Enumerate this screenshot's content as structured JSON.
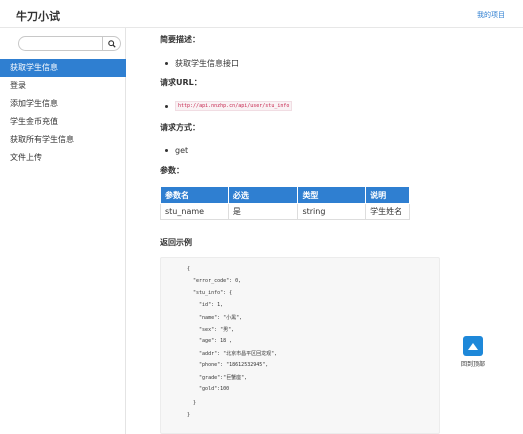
{
  "header": {
    "brand": "牛刀小试",
    "my_projects": "我的项目"
  },
  "search": {
    "value": "",
    "placeholder": ""
  },
  "sidebar": {
    "items": [
      {
        "label": "获取学生信息",
        "active": true
      },
      {
        "label": "登录"
      },
      {
        "label": "添加学生信息"
      },
      {
        "label": "学生金币充值"
      },
      {
        "label": "获取所有学生信息"
      },
      {
        "label": "文件上传"
      }
    ]
  },
  "doc": {
    "summary_heading": "简要描述：",
    "summary_text": "获取学生信息接口",
    "url_heading": "请求URL：",
    "url": "http://api.nnzhp.cn/api/user/stu_info",
    "method_heading": "请求方式：",
    "method": "get",
    "params_heading": "参数：",
    "params_table": {
      "headers": [
        "参数名",
        "必选",
        "类型",
        "说明"
      ],
      "rows": [
        [
          "stu_name",
          "是",
          "string",
          "学生姓名"
        ]
      ]
    },
    "return_heading": "返回示例",
    "code": [
      "{",
      "  \"error_code\": 0,",
      "  \"stu_info\": {",
      "    \"id\": 1,",
      "    \"name\": \"小黑\",",
      "    \"sex\": \"男\",",
      "    \"age\": 18 ,",
      "    \"addr\": \"北京市昌平区回龙观\",",
      "    \"phone\": \"18612532945\",",
      "    \"grade\":\"巨蟹座\",",
      "    \"gold\":100",
      "  }",
      "}"
    ]
  },
  "back_to_top": {
    "label": "回到顶部",
    "icon": "chevron-up-icon"
  },
  "colors": {
    "accent": "#2f7fd1",
    "code_bg": "#f7f7f7",
    "string": "#c7254e"
  }
}
